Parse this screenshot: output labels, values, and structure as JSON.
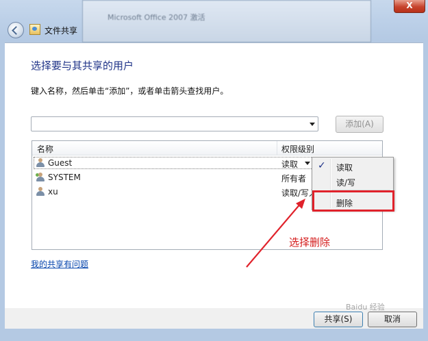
{
  "window": {
    "background_title": "Microsoft Office 2007 激活",
    "title": "文件共享",
    "close_label": "X"
  },
  "dialog": {
    "heading": "选择要与其共享的用户",
    "instruction": "键入名称，然后单击“添加”，或者单击箭头查找用户。",
    "add_button": "添加(A)",
    "columns": {
      "name": "名称",
      "permission": "权限级别"
    },
    "rows": [
      {
        "name": "Guest",
        "permission": "读取",
        "icon": "user-icon"
      },
      {
        "name": "SYSTEM",
        "permission": "所有者",
        "icon": "group-icon"
      },
      {
        "name": "xu",
        "permission": "读取/写入",
        "icon": "user-icon"
      }
    ],
    "help_link": "我的共享有问题",
    "share_button": "共享(S)",
    "cancel_button": "取消"
  },
  "context_menu": {
    "items": [
      "读取",
      "读/写",
      "删除"
    ],
    "checked": "读取"
  },
  "annotation": {
    "text": "选择删除",
    "color": "#d41c1c"
  },
  "watermark": "Baidu 经验"
}
